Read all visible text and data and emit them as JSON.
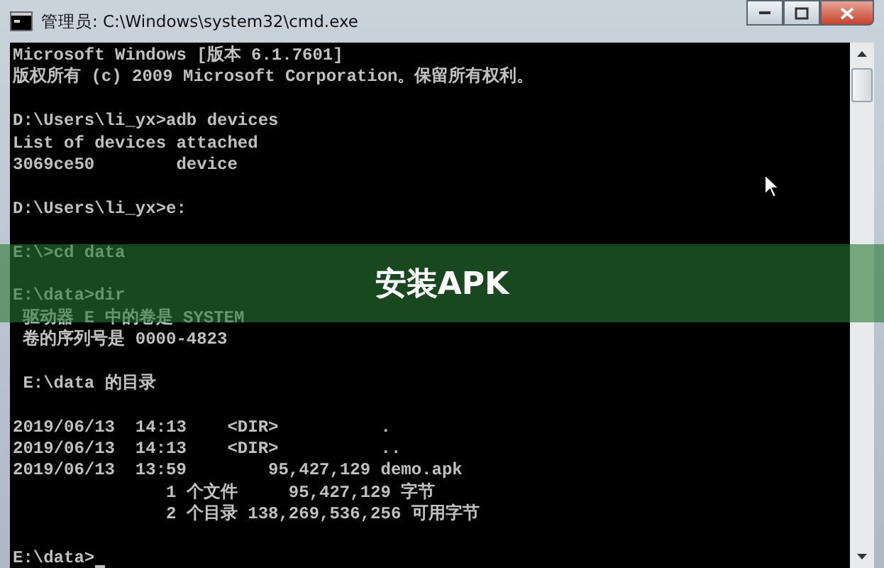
{
  "window": {
    "title": "管理员: C:\\Windows\\system32\\cmd.exe"
  },
  "console": {
    "blocks": [
      [
        "Microsoft Windows [版本 6.1.7601]",
        "版权所有 (c) 2009 Microsoft Corporation。保留所有权利。"
      ],
      [
        "D:\\Users\\li_yx>adb devices",
        "List of devices attached",
        "3069ce50        device"
      ],
      [
        "D:\\Users\\li_yx>e:"
      ],
      [
        "E:\\>cd data"
      ],
      [
        "E:\\data>dir",
        " 驱动器 E 中的卷是 SYSTEM",
        " 卷的序列号是 0000-4823"
      ],
      [
        " E:\\data 的目录"
      ],
      [
        "2019/06/13  14:13    <DIR>          .",
        "2019/06/13  14:13    <DIR>          ..",
        "2019/06/13  13:59        95,427,129 demo.apk",
        "               1 个文件     95,427,129 字节",
        "               2 个目录 138,269,536,256 可用字节"
      ]
    ],
    "prompt": "E:\\data>"
  },
  "banner": {
    "title": "安装APK"
  }
}
